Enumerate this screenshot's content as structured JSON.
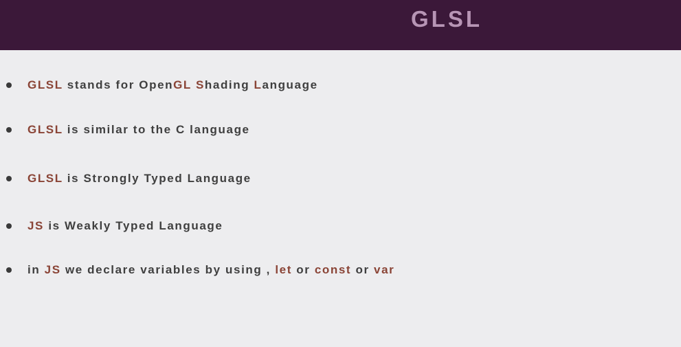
{
  "slide": {
    "title": "GLSL",
    "bullets": [
      {
        "segments": [
          {
            "text": "GLSL",
            "highlight": true
          },
          {
            "text": " stands for Open",
            "highlight": false
          },
          {
            "text": "GL",
            "highlight": true
          },
          {
            "text": " ",
            "highlight": false
          },
          {
            "text": "S",
            "highlight": true
          },
          {
            "text": "hading ",
            "highlight": false
          },
          {
            "text": "L",
            "highlight": true
          },
          {
            "text": "anguage",
            "highlight": false
          }
        ]
      },
      {
        "segments": [
          {
            "text": "GLSL",
            "highlight": true
          },
          {
            "text": " is similar to the C language",
            "highlight": false
          }
        ]
      },
      {
        "segments": [
          {
            "text": "GLSL",
            "highlight": true
          },
          {
            "text": " is Strongly Typed Language",
            "highlight": false
          }
        ]
      },
      {
        "segments": [
          {
            "text": "JS",
            "highlight": true
          },
          {
            "text": " is Weakly Typed Language",
            "highlight": false
          }
        ]
      },
      {
        "segments": [
          {
            "text": "in ",
            "highlight": false
          },
          {
            "text": "JS",
            "highlight": true
          },
          {
            "text": " we declare variables by using , ",
            "highlight": false
          },
          {
            "text": "let",
            "highlight": true
          },
          {
            "text": " or ",
            "highlight": false
          },
          {
            "text": "const",
            "highlight": true
          },
          {
            "text": " or ",
            "highlight": false
          },
          {
            "text": "var",
            "highlight": true
          }
        ]
      }
    ]
  },
  "colors": {
    "header_background": "#3b1839",
    "title_color": "#b795b5",
    "highlight_color": "#8a4436",
    "body_text_color": "#3f3f3f",
    "background": "#ededef"
  }
}
